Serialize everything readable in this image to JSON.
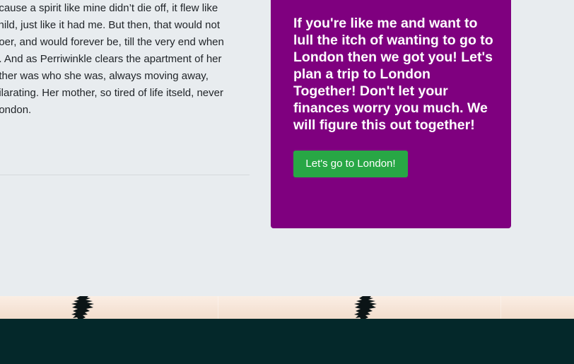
{
  "article": {
    "lines": [
      "ecause a spirit like mine didn’t die off, it flew like",
      "child, just like it had me. But then, that would not",
      "goer, and would forever be, till the very end when",
      "e. And as Perriwinkle clears the apartment of her",
      "other was who she was, always moving away,",
      "nilarating. Her mother, so tired of life itseld, never",
      "London."
    ]
  },
  "cta": {
    "heading": "If you're like me and want to lull the itch of wanting to go to London then we got you! Let's plan a trip to London Together! Don't let your finances worry you much. We will figure this out together!",
    "button_label": "Let's go to London!"
  },
  "colors": {
    "cta_background": "#7f007f",
    "button_background": "#28a745",
    "footer_background": "#04282a",
    "page_background": "#e8ecef"
  }
}
